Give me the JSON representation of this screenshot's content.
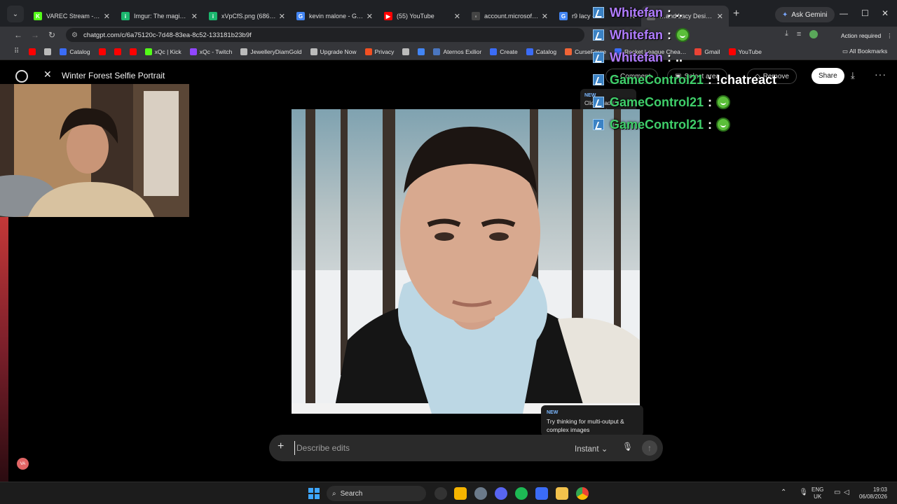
{
  "browser": {
    "tabs": [
      {
        "title": "VAREC Stream - Watch",
        "fav_color": "#53fc18",
        "fav_glyph": "K",
        "active": false
      },
      {
        "title": "Imgur: The magic of the",
        "fav_color": "#1bb76e",
        "fav_glyph": "i",
        "active": false
      },
      {
        "title": "xVpCfS.png (686×38…",
        "fav_color": "#1bb76e",
        "fav_glyph": "i",
        "active": false
      },
      {
        "title": "kevin malone - Google",
        "fav_color": "#4285f4",
        "fav_glyph": "G",
        "active": false
      },
      {
        "title": "(55) YouTube",
        "fav_color": "#ff0000",
        "fav_glyph": "▶",
        "active": false
      },
      {
        "title": "account.microsoft.com",
        "fav_color": "#444444",
        "fav_glyph": "◦",
        "active": false
      },
      {
        "title": "r9 lacy - Go",
        "fav_color": "#4285f4",
        "fav_glyph": "G",
        "active": false
      },
      {
        "title": "…and Lacy Desi…",
        "fav_color": "#666666",
        "fav_glyph": "◦",
        "active": true
      }
    ],
    "ask_gemini_label": "Ask Gemini",
    "url": "chatgpt.com/c/6a75120c-7d48-83ea-8c52-133181b23b9f",
    "action_required_label": "Action required",
    "bookmarks": [
      {
        "label": "",
        "color": "#ff0000"
      },
      {
        "label": "",
        "color": "#bbbbbb"
      },
      {
        "label": "Catalog",
        "color": "#3b6cf6"
      },
      {
        "label": "",
        "color": "#ff0000"
      },
      {
        "label": "",
        "color": "#ff0000"
      },
      {
        "label": "",
        "color": "#ff0000"
      },
      {
        "label": "xQc | Kick",
        "color": "#53fc18"
      },
      {
        "label": "xQc - Twitch",
        "color": "#9146ff"
      },
      {
        "label": "JewelleryDiamGold",
        "color": "#bbbbbb"
      },
      {
        "label": "Upgrade Now",
        "color": "#bbbbbb"
      },
      {
        "label": "Privacy",
        "color": "#f25022"
      },
      {
        "label": "",
        "color": "#bbbbbb"
      },
      {
        "label": "",
        "color": "#4285f4"
      },
      {
        "label": "Aternos Exilior",
        "color": "#4a76c0"
      },
      {
        "label": "Create",
        "color": "#3b6cf6"
      },
      {
        "label": "Catalog",
        "color": "#3b6cf6"
      },
      {
        "label": "CurseForge",
        "color": "#f16436"
      },
      {
        "label": "Rocket League Chea…",
        "color": "#3b6cf6"
      },
      {
        "label": "Gmail",
        "color": "#ea4335"
      },
      {
        "label": "YouTube",
        "color": "#ff0000"
      }
    ],
    "all_bookmarks_label": "All Bookmarks"
  },
  "chatgpt": {
    "title": "Winter Forest Selfie Portrait",
    "comment_label": "Comment",
    "select_label": "Select area",
    "remove_label": "Remove",
    "share_label": "Share",
    "tip_top_new": "NEW",
    "tip_top_text": "Click to add comments",
    "tip_bottom_new": "NEW",
    "tip_bottom_text": "Try thinking for multi-output & complex images",
    "composer_placeholder": "Describe edits",
    "mode_label": "Instant",
    "avatar_initials": "VA"
  },
  "chat_overlay": [
    {
      "user": "Whitefan",
      "color": "#b07cff",
      "msg": "..",
      "emote": false
    },
    {
      "user": "Whitefan",
      "color": "#b07cff",
      "msg": "",
      "emote": true
    },
    {
      "user": "Whitefan",
      "color": "#b07cff",
      "msg": "..",
      "emote": false
    },
    {
      "user": "GameControl21",
      "color": "#3fcf6a",
      "msg": "!chatreact",
      "emote": false
    },
    {
      "user": "GameControl21",
      "color": "#3fcf6a",
      "msg": "",
      "emote": true
    },
    {
      "user": "GameControl21",
      "color": "#3fcf6a",
      "msg": "",
      "emote": true
    }
  ],
  "taskbar": {
    "search_label": "Search",
    "lang_line1": "ENG",
    "lang_line2": "UK",
    "time": "19:03",
    "date": "06/08/2026"
  }
}
